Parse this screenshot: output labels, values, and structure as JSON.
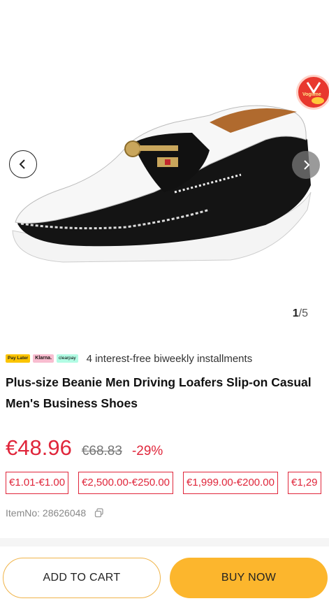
{
  "gallery": {
    "counter_current": "1",
    "counter_total": "/5",
    "badge_text": "Vogiime"
  },
  "installments": {
    "chips": [
      "Pay Later",
      "Klarna.",
      "clearpay"
    ],
    "text": "4 interest-free biweekly installments"
  },
  "product": {
    "title": "Plus-size Beanie Men Driving Loafers Slip-on Casual Men's Business Shoes",
    "price": "€48.96",
    "old_price": "€68.83",
    "discount": "-29%",
    "price_ranges": [
      "€1.01-€1.00",
      "€2,500.00-€250.00",
      "€1,999.00-€200.00",
      "€1,29"
    ],
    "item_no_label": "ItemNo: 28626048"
  },
  "actions": {
    "add_to_cart": "ADD TO CART",
    "buy_now": "BUY NOW"
  },
  "colors": {
    "accent_red": "#e0263b",
    "buy_yellow": "#fcb62d"
  }
}
